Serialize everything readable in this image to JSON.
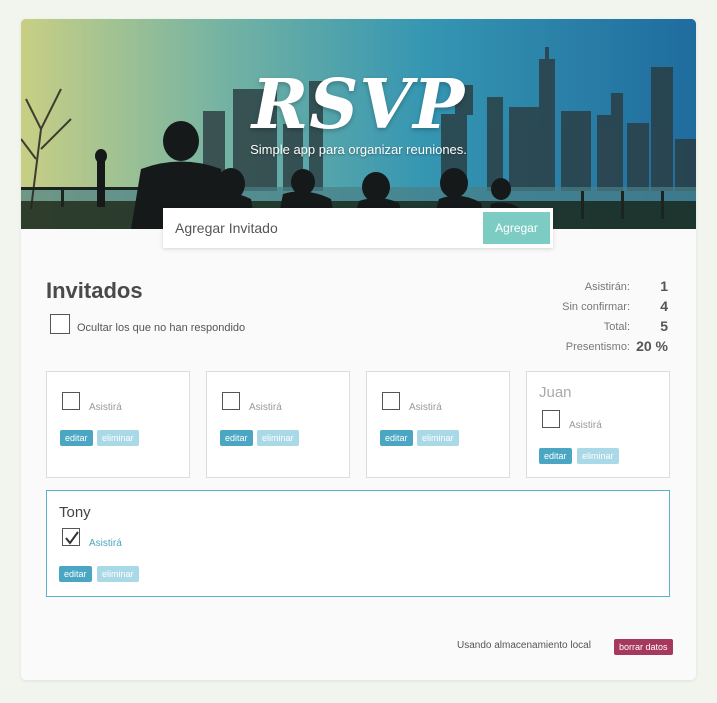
{
  "header": {
    "logo": "RSVP",
    "tagline": "Simple app para organizar reuniones."
  },
  "add_form": {
    "placeholder": "Agregar Invitado",
    "button_label": "Agregar"
  },
  "main": {
    "title": "Invitados",
    "filter_label": "Ocultar los que no han respondido"
  },
  "stats": [
    {
      "label": "Asistirán:",
      "value": "1"
    },
    {
      "label": "Sin confirmar:",
      "value": "4"
    },
    {
      "label": "Total:",
      "value": "5"
    },
    {
      "label": "Presentismo:",
      "value": "20 %"
    }
  ],
  "guests": [
    {
      "name": "",
      "attend_label": "Asistirá",
      "checked": false,
      "edit_label": "editar",
      "delete_label": "eliminar"
    },
    {
      "name": "",
      "attend_label": "Asistirá",
      "checked": false,
      "edit_label": "editar",
      "delete_label": "eliminar"
    },
    {
      "name": "",
      "attend_label": "Asistirá",
      "checked": false,
      "edit_label": "editar",
      "delete_label": "eliminar"
    },
    {
      "name": "Juan",
      "attend_label": "Asistirá",
      "checked": false,
      "edit_label": "editar",
      "delete_label": "eliminar"
    },
    {
      "name": "Tony",
      "attend_label": "Asistirá",
      "checked": true,
      "edit_label": "editar",
      "delete_label": "eliminar"
    }
  ],
  "footer": {
    "storage_text": "Usando almacenamiento local",
    "clear_label": "borrar datos"
  },
  "colors": {
    "accent": "#7dccc4",
    "edit": "#4aa6c2",
    "delete": "#a9d8e6",
    "danger": "#a5385c",
    "confirmed_border": "#5ab3c6"
  }
}
